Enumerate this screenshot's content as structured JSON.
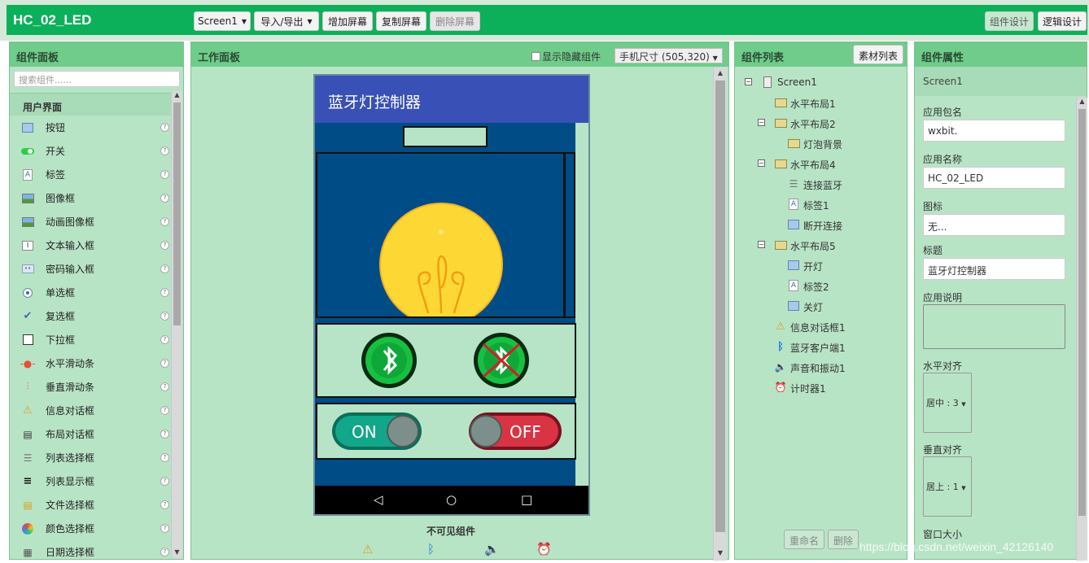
{
  "header": {
    "app_title": "HC_02_LED",
    "screen_select": "Screen1",
    "import_export": "导入/导出",
    "add_screen": "增加屏幕",
    "copy_screen": "复制屏幕",
    "delete_screen": "删除屏幕",
    "designer": "组件设计",
    "blocks": "逻辑设计"
  },
  "palette": {
    "title": "组件面板",
    "search_placeholder": "搜索组件......",
    "section": "用户界面",
    "items": [
      {
        "label": "按钮",
        "icon": "button-icon"
      },
      {
        "label": "开关",
        "icon": "switch-icon"
      },
      {
        "label": "标签",
        "icon": "label-icon"
      },
      {
        "label": "图像框",
        "icon": "image-icon"
      },
      {
        "label": "动画图像框",
        "icon": "animated-image-icon"
      },
      {
        "label": "文本输入框",
        "icon": "textbox-icon"
      },
      {
        "label": "密码输入框",
        "icon": "password-icon"
      },
      {
        "label": "单选框",
        "icon": "radio-icon"
      },
      {
        "label": "复选框",
        "icon": "checkbox-icon"
      },
      {
        "label": "下拉框",
        "icon": "spinner-icon"
      },
      {
        "label": "水平滑动条",
        "icon": "hslider-icon"
      },
      {
        "label": "垂直滑动条",
        "icon": "vslider-icon"
      },
      {
        "label": "信息对话框",
        "icon": "notifier-icon"
      },
      {
        "label": "布局对话框",
        "icon": "layout-dialog-icon"
      },
      {
        "label": "列表选择框",
        "icon": "listpicker-icon"
      },
      {
        "label": "列表显示框",
        "icon": "listview-icon"
      },
      {
        "label": "文件选择框",
        "icon": "filepicker-icon"
      },
      {
        "label": "颜色选择框",
        "icon": "colorpicker-icon"
      },
      {
        "label": "日期选择框",
        "icon": "datepicker-icon"
      }
    ]
  },
  "workspace": {
    "title": "工作面板",
    "show_hidden": "显示隐藏组件",
    "phone_size": "手机尺寸 (505,320)",
    "screen_title": "蓝牙灯控制器",
    "switch_on": "ON",
    "switch_off": "OFF",
    "invisible_title": "不可见组件"
  },
  "components": {
    "title": "组件列表",
    "assets_button": "素材列表",
    "tree": [
      {
        "label": "Screen1",
        "level": 0,
        "toggle": "−",
        "icon": "screen-icon"
      },
      {
        "label": "水平布局1",
        "level": 1,
        "toggle": "",
        "icon": "hlayout-icon"
      },
      {
        "label": "水平布局2",
        "level": 1,
        "toggle": "−",
        "icon": "hlayout-icon"
      },
      {
        "label": "灯泡背景",
        "level": 2,
        "toggle": "",
        "icon": "hlayout-icon"
      },
      {
        "label": "水平布局4",
        "level": 1,
        "toggle": "−",
        "icon": "hlayout-icon"
      },
      {
        "label": "连接蓝牙",
        "level": 2,
        "toggle": "",
        "icon": "listpicker-icon"
      },
      {
        "label": "标签1",
        "level": 2,
        "toggle": "",
        "icon": "label-icon"
      },
      {
        "label": "断开连接",
        "level": 2,
        "toggle": "",
        "icon": "button-icon"
      },
      {
        "label": "水平布局5",
        "level": 1,
        "toggle": "−",
        "icon": "hlayout-icon"
      },
      {
        "label": "开灯",
        "level": 2,
        "toggle": "",
        "icon": "button-icon"
      },
      {
        "label": "标签2",
        "level": 2,
        "toggle": "",
        "icon": "label-icon"
      },
      {
        "label": "关灯",
        "level": 2,
        "toggle": "",
        "icon": "button-icon"
      },
      {
        "label": "信息对话框1",
        "level": 1,
        "toggle": "",
        "icon": "notifier-icon"
      },
      {
        "label": "蓝牙客户端1",
        "level": 1,
        "toggle": "",
        "icon": "bluetooth-icon"
      },
      {
        "label": "声音和振动1",
        "level": 1,
        "toggle": "",
        "icon": "sound-icon"
      },
      {
        "label": "计时器1",
        "level": 1,
        "toggle": "",
        "icon": "clock-icon"
      }
    ],
    "rename": "重命名",
    "delete": "删除"
  },
  "properties": {
    "title": "组件属性",
    "component": "Screen1",
    "app_package_label": "应用包名",
    "app_package": "wxbit.",
    "app_name_label": "应用名称",
    "app_name": "HC_02_LED",
    "icon_label": "图标",
    "icon_value": "无...",
    "title_label": "标题",
    "title_value": "蓝牙灯控制器",
    "about_label": "应用说明",
    "halign_label": "水平对齐",
    "halign_value": "居中 : 3",
    "valign_label": "垂直对齐",
    "valign_value": "居上 : 1",
    "window_size_label": "窗口大小"
  },
  "watermark": "https://blog.csdn.net/weixin_42126140",
  "colors": {
    "brand": "#0db05a",
    "panel": "#b8e4c6",
    "phone_bg": "#004c86",
    "titlebar": "#3950b6"
  }
}
